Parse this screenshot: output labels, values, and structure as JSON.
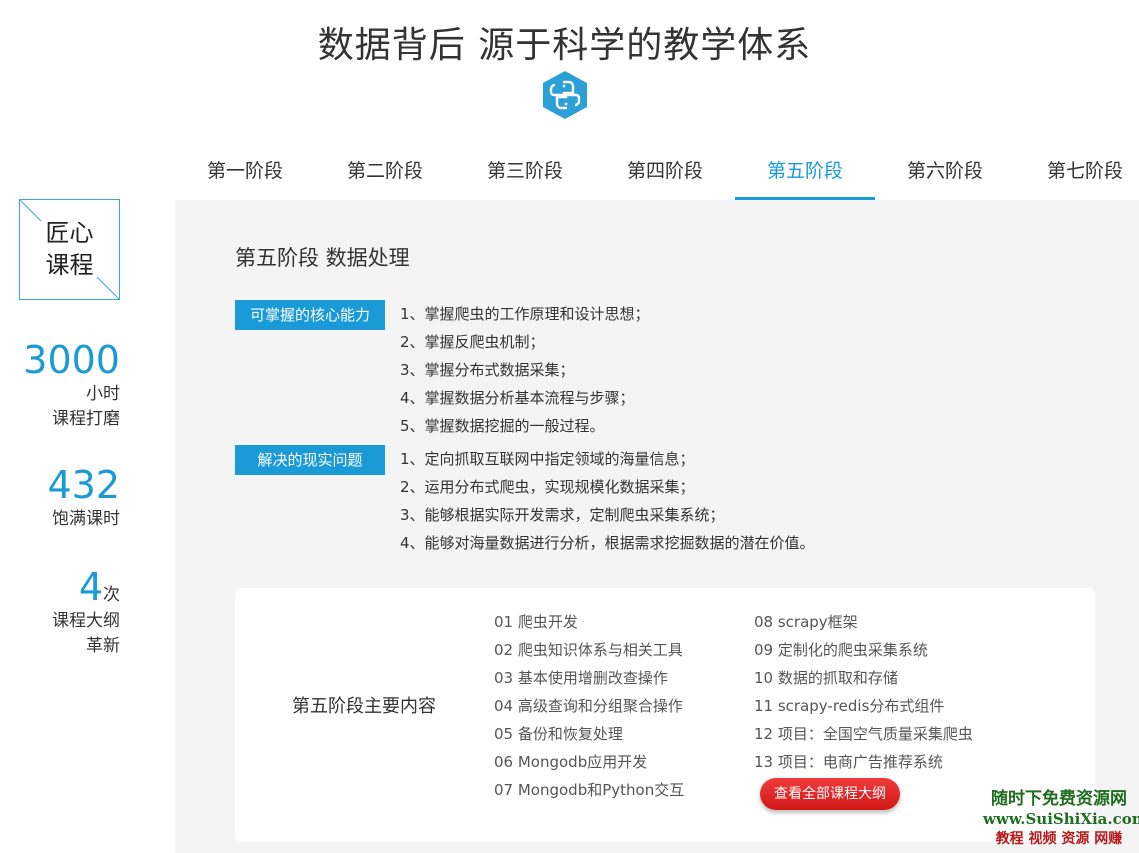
{
  "header": {
    "title": "数据背后  源于科学的教学体系",
    "logo_icon": "python-icon"
  },
  "tabs": [
    {
      "label": "第一阶段",
      "active": false
    },
    {
      "label": "第二阶段",
      "active": false
    },
    {
      "label": "第三阶段",
      "active": false
    },
    {
      "label": "第四阶段",
      "active": false
    },
    {
      "label": "第五阶段",
      "active": true
    },
    {
      "label": "第六阶段",
      "active": false
    },
    {
      "label": "第七阶段",
      "active": false
    }
  ],
  "sidebar": {
    "craft_label_line1": "匠心",
    "craft_label_line2": "课程",
    "stats": [
      {
        "num": "3000",
        "line1": "小时",
        "line2": "课程打磨"
      },
      {
        "num": "432",
        "line1": "饱满课时"
      },
      {
        "num": "4",
        "unit": "次",
        "line1": "课程大纲",
        "line2": "革新"
      }
    ]
  },
  "stage": {
    "title": "第五阶段  数据处理",
    "ability_tag": "可掌握的核心能力",
    "abilities": [
      "1、掌握爬虫的工作原理和设计思想；",
      "2、掌握反爬虫机制；",
      "3、掌握分布式数据采集；",
      "4、掌握数据分析基本流程与步骤；",
      "5、掌握数据挖掘的一般过程。"
    ],
    "problem_tag": "解决的现实问题",
    "problems": [
      "1、定向抓取互联网中指定领域的海量信息；",
      "2、运用分布式爬虫，实现规模化数据采集；",
      "3、能够根据实际开发需求，定制爬虫采集系统；",
      "4、能够对海量数据进行分析，根据需求挖掘数据的潜在价值。"
    ]
  },
  "contents": {
    "label": "第五阶段主要内容",
    "col1": [
      "01 爬虫开发",
      "02 爬虫知识体系与相关工具",
      "03 基本使用增删改查操作",
      "04 高级查询和分组聚合操作",
      "05 备份和恢复处理",
      "06 Mongodb应用开发",
      "07 Mongodb和Python交互"
    ],
    "col2": [
      "08 scrapy框架",
      "09 定制化的爬虫采集系统",
      "10 数据的抓取和存储",
      "11 scrapy-redis分布式组件",
      "12 项目：全国空气质量采集爬虫",
      "13 项目：电商广告推荐系统"
    ],
    "cta_label": "查看全部课程大纲"
  },
  "watermark": {
    "line1": "随时下免费资源网",
    "line2": "www.SuiShiXia.com",
    "line3": "教程 视频 资源 网赚"
  },
  "colors": {
    "accent": "#1a9ad6",
    "cta": "#e02424",
    "panel_bg": "#f4f4f4"
  }
}
